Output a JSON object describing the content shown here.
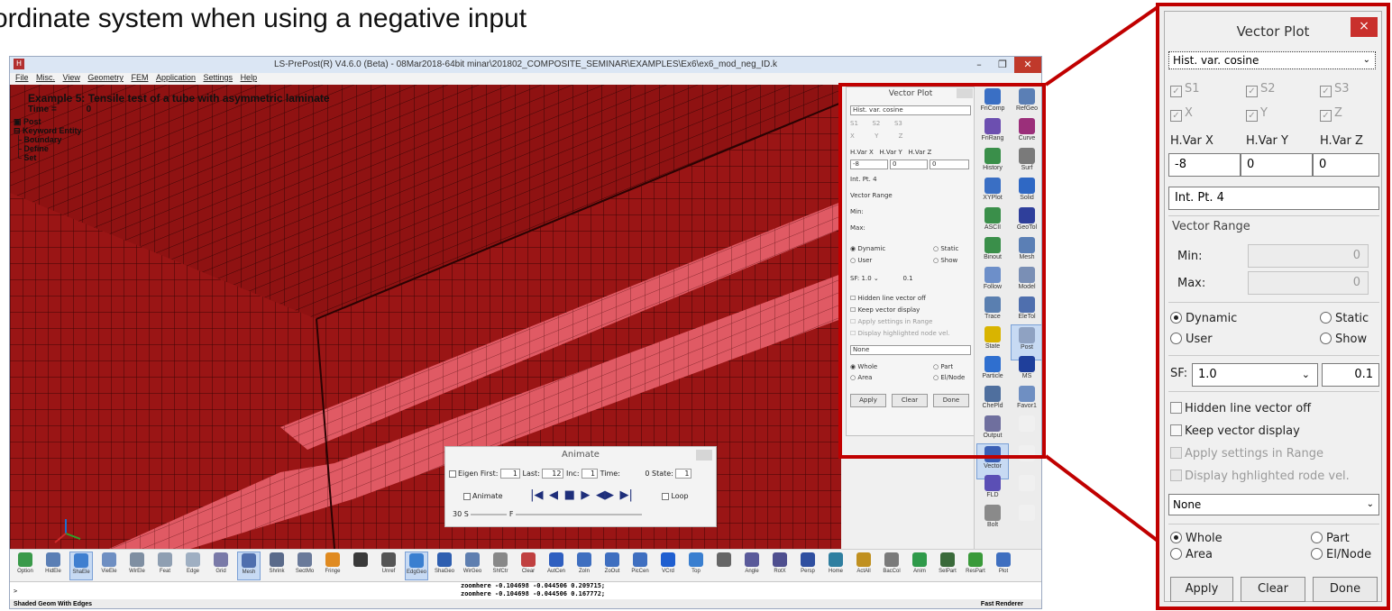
{
  "slide": {
    "title_fragment": "ordinate system when using a negative input"
  },
  "app": {
    "window_title": "LS-PrePost(R) V4.6.0 (Beta) - 08Mar2018-64bit minar\\201802_COMPOSITE_SEMINAR\\EXAMPLES\\Ex6\\ex6_mod_neg_ID.k",
    "icon_letter": "H",
    "menu": [
      "File",
      "Misc.",
      "View",
      "Geometry",
      "FEM",
      "Application",
      "Settings",
      "Help"
    ],
    "viewport": {
      "title": "Example 5: Tensile test of a tube with asymmetric laminate",
      "time_label": "Time =",
      "time_value": "0",
      "tree": [
        "Post",
        "Keyword Entity",
        "Boundary",
        "Define",
        "Set"
      ]
    },
    "right_toolbar": [
      {
        "label": "FriComp",
        "color": "#3a6fc4"
      },
      {
        "label": "RefGeo",
        "color": "#5b7fb5"
      },
      {
        "label": "FriRang",
        "color": "#6c4fb0"
      },
      {
        "label": "Curve",
        "color": "#9b2f7a"
      },
      {
        "label": "History",
        "color": "#3a8f4a"
      },
      {
        "label": "Surf",
        "color": "#7a7a7a"
      },
      {
        "label": "XYPlot",
        "color": "#3a6fc4"
      },
      {
        "label": "Solid",
        "color": "#2f68c4"
      },
      {
        "label": "ASCII",
        "color": "#3a8f4a"
      },
      {
        "label": "GeoTol",
        "color": "#2f3f9b"
      },
      {
        "label": "Binout",
        "color": "#3a8f4a"
      },
      {
        "label": "Mesh",
        "color": "#5b7fb5"
      },
      {
        "label": "Follow",
        "color": "#6d8fc9"
      },
      {
        "label": "Model",
        "color": "#7a8fb5"
      },
      {
        "label": "Trace",
        "color": "#5a7fb0"
      },
      {
        "label": "EleTol",
        "color": "#4f6fae"
      },
      {
        "label": "State",
        "color": "#d9b400"
      },
      {
        "label": "Post",
        "color": "#8fa2c2"
      },
      {
        "label": "Particle",
        "color": "#2f6fcf"
      },
      {
        "label": "MS",
        "color": "#1f3f9b"
      },
      {
        "label": "ChePld",
        "color": "#4f6f9e"
      },
      {
        "label": "Favor1",
        "color": "#6f8fc2"
      },
      {
        "label": "Output",
        "color": "#6f6f9e"
      },
      {
        "label": "",
        "color": "#f0f0f0"
      },
      {
        "label": "Vector",
        "color": "#3a5fb5"
      },
      {
        "label": "",
        "color": "#f0f0f0"
      },
      {
        "label": "FLD",
        "color": "#5b4fb5"
      },
      {
        "label": "",
        "color": "#f0f0f0"
      },
      {
        "label": "Bolt",
        "color": "#8a8a8a"
      },
      {
        "label": "",
        "color": "#f0f0f0"
      }
    ],
    "bottom_toolbar": [
      "Option",
      "HidEle",
      "ShaEle",
      "VieEle",
      "WirEle",
      "Feat",
      "Edge",
      "Grid",
      "Mesh",
      "Shrink",
      "SectMo",
      "Fringe",
      "",
      "Unref",
      "EdgGeo",
      "ShaGeo",
      "WirGeo",
      "ShfCtr",
      "Clear",
      "AutCen",
      "ZoIn",
      "ZoOut",
      "PicCen",
      "VCrd",
      "Top",
      "",
      "Angle",
      "RotX",
      "Persp",
      "Home",
      "ActAll",
      "BacCol",
      "Anim",
      "SelPart",
      "ResPart",
      "Plot"
    ],
    "command_prompt": ">",
    "command_log": [
      "zoomhere -0.104698 -0.044506 0.209715;",
      "zoomhere -0.104698 -0.044506 0.167772;"
    ],
    "status_left": "Shaded Geom With Edges",
    "status_right": "Fast Renderer",
    "animate": {
      "title": "Animate",
      "eigen": "Eigen",
      "first_label": "First:",
      "first_value": "1",
      "last_label": "Last:",
      "last_value": "12",
      "inc_label": "Inc:",
      "inc_value": "1",
      "time_label": "Time:",
      "time_value": "0",
      "state_label": "State:",
      "state_value": "1",
      "animate_label": "Animate",
      "loop_label": "Loop",
      "speed": "30 S",
      "f_label": "F"
    },
    "small_panel": {
      "title": "Vector Plot",
      "select": "Hist. var. cosine",
      "s": [
        "S1",
        "S2",
        "S3"
      ],
      "xyz": [
        "X",
        "Y",
        "Z"
      ],
      "hvars": [
        "H.Var X",
        "H.Var Y",
        "H.Var Z"
      ],
      "hvals": [
        "-8",
        "0",
        "0"
      ],
      "intpt": "Int. Pt.",
      "intpt_val": "4",
      "range": "Vector Range",
      "min": "Min:",
      "max": "Max:",
      "zero": "0",
      "dynamic": "Dynamic",
      "static": "Static",
      "user": "User",
      "show": "Show",
      "sf": "SF:",
      "sf_val": "1.0",
      "sf_num": "0.1",
      "hidden": "Hidden line vector off",
      "keep": "Keep vector display",
      "apply_range": "Apply settings in Range",
      "display_hl": "Display highlighted node vel.",
      "none": "None",
      "whole": "Whole",
      "part": "Part",
      "area": "Area",
      "elnode": "El/Node",
      "apply": "Apply",
      "clear": "Clear",
      "done": "Done"
    }
  },
  "zoom_panel": {
    "title": "Vector Plot",
    "close": "×",
    "select": "Hist. var. cosine",
    "s1": "S1",
    "s2": "S2",
    "s3": "S3",
    "x": "X",
    "y": "Y",
    "z": "Z",
    "hvar_x": "H.Var X",
    "hvar_y": "H.Var Y",
    "hvar_z": "H.Var Z",
    "hval_x": "-8",
    "hval_y": "0",
    "hval_z": "0",
    "intpt_label": "Int. Pt.",
    "intpt_value": "4",
    "range_label": "Vector Range",
    "min_label": "Min:",
    "max_label": "Max:",
    "min_value": "0",
    "max_value": "0",
    "dynamic": "Dynamic",
    "static": "Static",
    "user": "User",
    "show": "Show",
    "sf_label": "SF:",
    "sf_select": "1.0",
    "sf_value": "0.1",
    "hidden_line": "Hidden line vector off",
    "keep_vector": "Keep vector display",
    "apply_range": "Apply settings in Range",
    "display_hl": "Display hghlighted rode vel.",
    "none_select": "None",
    "whole": "Whole",
    "part": "Part",
    "area": "Area",
    "elnode": "El/Node",
    "apply": "Apply",
    "clear": "Clear",
    "done": "Done"
  },
  "colors": {
    "mesh_dark": "#8c1010",
    "mesh_band": "#e05a64",
    "callout": "#c00000",
    "close_button": "#c9302c"
  }
}
